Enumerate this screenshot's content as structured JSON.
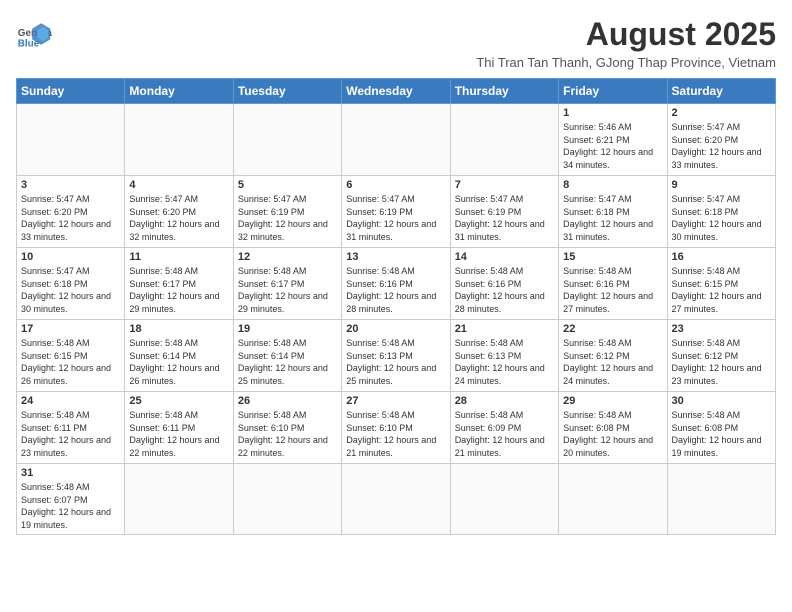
{
  "header": {
    "logo_general": "General",
    "logo_blue": "Blue",
    "month_title": "August 2025",
    "subtitle": "Thi Tran Tan Thanh, GJong Thap Province, Vietnam"
  },
  "days_of_week": [
    "Sunday",
    "Monday",
    "Tuesday",
    "Wednesday",
    "Thursday",
    "Friday",
    "Saturday"
  ],
  "weeks": [
    [
      {
        "day": "",
        "info": ""
      },
      {
        "day": "",
        "info": ""
      },
      {
        "day": "",
        "info": ""
      },
      {
        "day": "",
        "info": ""
      },
      {
        "day": "",
        "info": ""
      },
      {
        "day": "1",
        "info": "Sunrise: 5:46 AM\nSunset: 6:21 PM\nDaylight: 12 hours and 34 minutes."
      },
      {
        "day": "2",
        "info": "Sunrise: 5:47 AM\nSunset: 6:20 PM\nDaylight: 12 hours and 33 minutes."
      }
    ],
    [
      {
        "day": "3",
        "info": "Sunrise: 5:47 AM\nSunset: 6:20 PM\nDaylight: 12 hours and 33 minutes."
      },
      {
        "day": "4",
        "info": "Sunrise: 5:47 AM\nSunset: 6:20 PM\nDaylight: 12 hours and 32 minutes."
      },
      {
        "day": "5",
        "info": "Sunrise: 5:47 AM\nSunset: 6:19 PM\nDaylight: 12 hours and 32 minutes."
      },
      {
        "day": "6",
        "info": "Sunrise: 5:47 AM\nSunset: 6:19 PM\nDaylight: 12 hours and 31 minutes."
      },
      {
        "day": "7",
        "info": "Sunrise: 5:47 AM\nSunset: 6:19 PM\nDaylight: 12 hours and 31 minutes."
      },
      {
        "day": "8",
        "info": "Sunrise: 5:47 AM\nSunset: 6:18 PM\nDaylight: 12 hours and 31 minutes."
      },
      {
        "day": "9",
        "info": "Sunrise: 5:47 AM\nSunset: 6:18 PM\nDaylight: 12 hours and 30 minutes."
      }
    ],
    [
      {
        "day": "10",
        "info": "Sunrise: 5:47 AM\nSunset: 6:18 PM\nDaylight: 12 hours and 30 minutes."
      },
      {
        "day": "11",
        "info": "Sunrise: 5:48 AM\nSunset: 6:17 PM\nDaylight: 12 hours and 29 minutes."
      },
      {
        "day": "12",
        "info": "Sunrise: 5:48 AM\nSunset: 6:17 PM\nDaylight: 12 hours and 29 minutes."
      },
      {
        "day": "13",
        "info": "Sunrise: 5:48 AM\nSunset: 6:16 PM\nDaylight: 12 hours and 28 minutes."
      },
      {
        "day": "14",
        "info": "Sunrise: 5:48 AM\nSunset: 6:16 PM\nDaylight: 12 hours and 28 minutes."
      },
      {
        "day": "15",
        "info": "Sunrise: 5:48 AM\nSunset: 6:16 PM\nDaylight: 12 hours and 27 minutes."
      },
      {
        "day": "16",
        "info": "Sunrise: 5:48 AM\nSunset: 6:15 PM\nDaylight: 12 hours and 27 minutes."
      }
    ],
    [
      {
        "day": "17",
        "info": "Sunrise: 5:48 AM\nSunset: 6:15 PM\nDaylight: 12 hours and 26 minutes."
      },
      {
        "day": "18",
        "info": "Sunrise: 5:48 AM\nSunset: 6:14 PM\nDaylight: 12 hours and 26 minutes."
      },
      {
        "day": "19",
        "info": "Sunrise: 5:48 AM\nSunset: 6:14 PM\nDaylight: 12 hours and 25 minutes."
      },
      {
        "day": "20",
        "info": "Sunrise: 5:48 AM\nSunset: 6:13 PM\nDaylight: 12 hours and 25 minutes."
      },
      {
        "day": "21",
        "info": "Sunrise: 5:48 AM\nSunset: 6:13 PM\nDaylight: 12 hours and 24 minutes."
      },
      {
        "day": "22",
        "info": "Sunrise: 5:48 AM\nSunset: 6:12 PM\nDaylight: 12 hours and 24 minutes."
      },
      {
        "day": "23",
        "info": "Sunrise: 5:48 AM\nSunset: 6:12 PM\nDaylight: 12 hours and 23 minutes."
      }
    ],
    [
      {
        "day": "24",
        "info": "Sunrise: 5:48 AM\nSunset: 6:11 PM\nDaylight: 12 hours and 23 minutes."
      },
      {
        "day": "25",
        "info": "Sunrise: 5:48 AM\nSunset: 6:11 PM\nDaylight: 12 hours and 22 minutes."
      },
      {
        "day": "26",
        "info": "Sunrise: 5:48 AM\nSunset: 6:10 PM\nDaylight: 12 hours and 22 minutes."
      },
      {
        "day": "27",
        "info": "Sunrise: 5:48 AM\nSunset: 6:10 PM\nDaylight: 12 hours and 21 minutes."
      },
      {
        "day": "28",
        "info": "Sunrise: 5:48 AM\nSunset: 6:09 PM\nDaylight: 12 hours and 21 minutes."
      },
      {
        "day": "29",
        "info": "Sunrise: 5:48 AM\nSunset: 6:08 PM\nDaylight: 12 hours and 20 minutes."
      },
      {
        "day": "30",
        "info": "Sunrise: 5:48 AM\nSunset: 6:08 PM\nDaylight: 12 hours and 19 minutes."
      }
    ],
    [
      {
        "day": "31",
        "info": "Sunrise: 5:48 AM\nSunset: 6:07 PM\nDaylight: 12 hours and 19 minutes."
      },
      {
        "day": "",
        "info": ""
      },
      {
        "day": "",
        "info": ""
      },
      {
        "day": "",
        "info": ""
      },
      {
        "day": "",
        "info": ""
      },
      {
        "day": "",
        "info": ""
      },
      {
        "day": "",
        "info": ""
      }
    ]
  ]
}
